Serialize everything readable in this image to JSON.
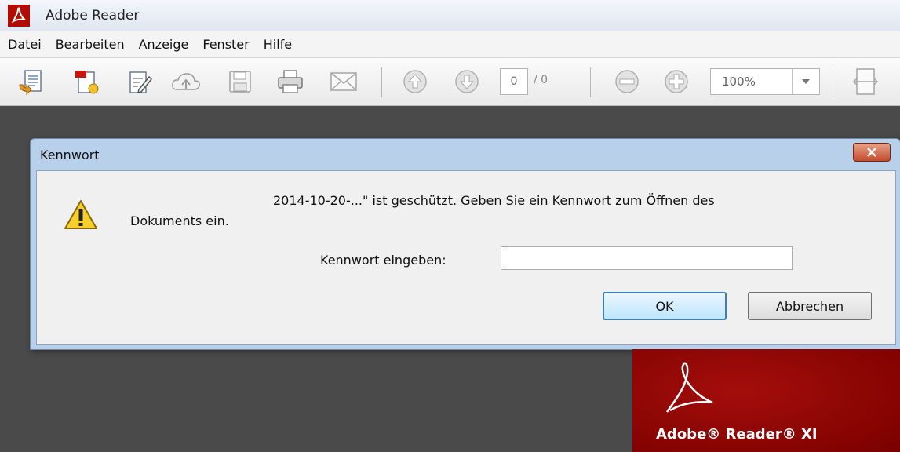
{
  "window": {
    "title": "Adobe Reader"
  },
  "menu": [
    "Datei",
    "Bearbeiten",
    "Anzeige",
    "Fenster",
    "Hilfe"
  ],
  "toolbar": {
    "icons": [
      "open-icon",
      "create-pdf-icon",
      "edit-icon",
      "cloud-upload-icon",
      "save-icon",
      "print-icon",
      "email-icon",
      "page-up-icon",
      "page-down-icon",
      "zoom-out-icon",
      "zoom-in-icon",
      "fit-width-icon"
    ],
    "page_current": "0",
    "page_total": "/ 0",
    "zoom": "100%"
  },
  "dialog": {
    "title": "Kennwort",
    "message_line1": "2014-10-20-...\" ist geschützt. Geben Sie ein Kennwort zum Öffnen des",
    "message_line2": "Dokuments ein.",
    "password_label": "Kennwort eingeben:",
    "password_value": "",
    "ok_label": "OK",
    "cancel_label": "Abbrechen"
  },
  "splash": {
    "brand": "Adobe® Reader® XI"
  },
  "colors": {
    "brand_red": "#a40e0a",
    "dialog_frame": "#b9d0ea",
    "background": "#4a4a4a"
  }
}
